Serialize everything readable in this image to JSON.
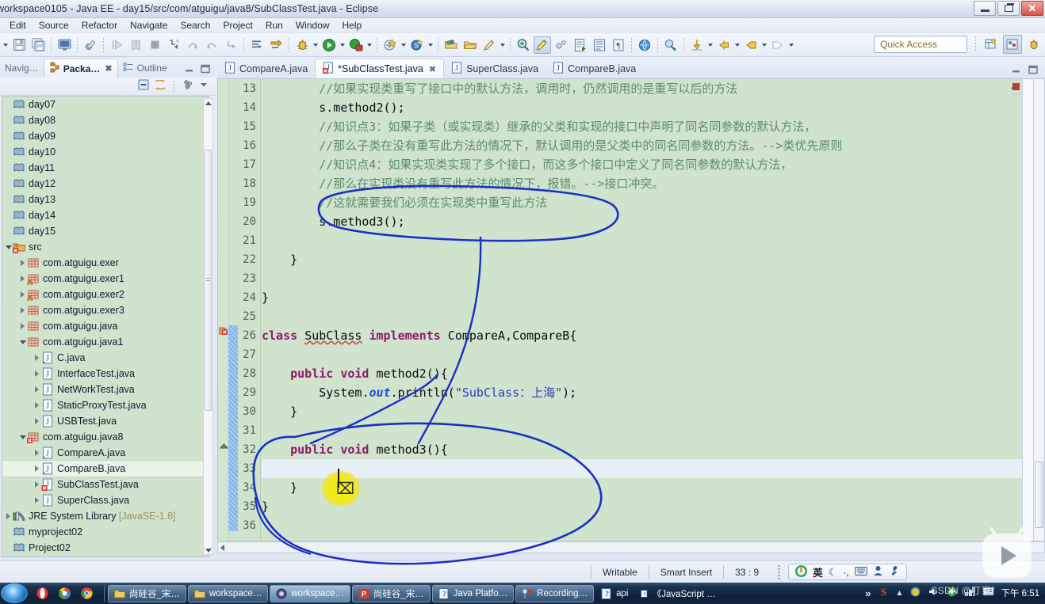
{
  "window": {
    "title": "workspace0105 - Java EE - day15/src/com/atguigu/java8/SubClassTest.java - Eclipse",
    "controls": {
      "minimize": "–",
      "restore": "❐",
      "close": "✕"
    }
  },
  "menu": {
    "items": [
      "Edit",
      "Source",
      "Refactor",
      "Navigate",
      "Search",
      "Project",
      "Run",
      "Window",
      "Help"
    ]
  },
  "toolbar": {
    "quick_access_placeholder": "Quick Access",
    "icons": [
      "save-icon",
      "save-all-icon",
      "console-icon",
      "skip-breakpoints-icon",
      "resume-icon",
      "suspend-icon",
      "terminate-icon",
      "step-into-icon",
      "step-over-icon",
      "step-return-icon",
      "drop-to-frame-icon",
      "use-step-filters-icon",
      "external-tools-icon",
      "debug-icon",
      "run-icon",
      "run-last-tool-icon",
      "new-java-project-icon",
      "new-java-class-icon",
      "open-type-icon",
      "open-task-icon",
      "edit-icon",
      "search-icon",
      "toggle-mark-occurrences-icon",
      "pin-editor-icon",
      "next-annotation-icon",
      "previous-annotation-icon",
      "last-edit-location-icon",
      "back-icon",
      "forward-icon"
    ]
  },
  "left_panel": {
    "tabs": [
      {
        "label": "Navig…",
        "icon": "navigator-icon",
        "active": false
      },
      {
        "label": "Packa…",
        "icon": "package-explorer-icon",
        "active": true,
        "closeable": true
      },
      {
        "label": "Outline",
        "icon": "outline-icon",
        "active": false
      }
    ],
    "view_controls": [
      "collapse-all-icon",
      "link-with-editor-icon",
      "view-menu-icon",
      "view-menu-chevron-icon"
    ],
    "tree": [
      {
        "label": "day07",
        "icon": "java-project-icon",
        "indent": 0,
        "arrow": "none"
      },
      {
        "label": "day08",
        "icon": "java-project-icon",
        "indent": 0,
        "arrow": "none"
      },
      {
        "label": "day09",
        "icon": "java-project-icon",
        "indent": 0,
        "arrow": "none"
      },
      {
        "label": "day10",
        "icon": "java-project-icon",
        "indent": 0,
        "arrow": "none"
      },
      {
        "label": "day11",
        "icon": "java-project-icon",
        "indent": 0,
        "arrow": "none"
      },
      {
        "label": "day12",
        "icon": "java-project-icon",
        "indent": 0,
        "arrow": "none"
      },
      {
        "label": "day13",
        "icon": "java-project-icon",
        "indent": 0,
        "arrow": "none"
      },
      {
        "label": "day14",
        "icon": "java-project-icon",
        "indent": 0,
        "arrow": "none"
      },
      {
        "label": "day15",
        "icon": "java-project-icon",
        "indent": 0,
        "arrow": "none"
      },
      {
        "label": "src",
        "icon": "source-folder-error-icon",
        "indent": 0,
        "arrow": "open"
      },
      {
        "label": "com.atguigu.exer",
        "icon": "package-icon",
        "indent": 1,
        "arrow": "closed"
      },
      {
        "label": "com.atguigu.exer1",
        "icon": "package-warning-icon",
        "indent": 1,
        "arrow": "closed"
      },
      {
        "label": "com.atguigu.exer2",
        "icon": "package-warning-icon",
        "indent": 1,
        "arrow": "closed"
      },
      {
        "label": "com.atguigu.exer3",
        "icon": "package-icon",
        "indent": 1,
        "arrow": "closed"
      },
      {
        "label": "com.atguigu.java",
        "icon": "package-icon",
        "indent": 1,
        "arrow": "closed"
      },
      {
        "label": "com.atguigu.java1",
        "icon": "package-icon",
        "indent": 1,
        "arrow": "open"
      },
      {
        "label": "C.java",
        "icon": "java-interface-file-icon",
        "indent": 2,
        "arrow": "closed"
      },
      {
        "label": "InterfaceTest.java",
        "icon": "java-file-icon",
        "indent": 2,
        "arrow": "closed"
      },
      {
        "label": "NetWorkTest.java",
        "icon": "java-file-icon",
        "indent": 2,
        "arrow": "closed"
      },
      {
        "label": "StaticProxyTest.java",
        "icon": "java-file-icon",
        "indent": 2,
        "arrow": "closed"
      },
      {
        "label": "USBTest.java",
        "icon": "java-file-icon",
        "indent": 2,
        "arrow": "closed"
      },
      {
        "label": "com.atguigu.java8",
        "icon": "package-error-icon",
        "indent": 1,
        "arrow": "open"
      },
      {
        "label": "CompareA.java",
        "icon": "java-interface-file-icon",
        "indent": 2,
        "arrow": "closed"
      },
      {
        "label": "CompareB.java",
        "icon": "java-interface-file-icon",
        "indent": 2,
        "arrow": "closed",
        "selected": true
      },
      {
        "label": "SubClassTest.java",
        "icon": "java-file-error-icon",
        "indent": 2,
        "arrow": "closed"
      },
      {
        "label": "SuperClass.java",
        "icon": "java-file-icon",
        "indent": 2,
        "arrow": "closed"
      },
      {
        "label": "JRE System Library",
        "suffix": "[JavaSE-1.8]",
        "icon": "jre-library-icon",
        "indent": 0,
        "arrow": "closed"
      },
      {
        "label": "myproject02",
        "icon": "java-project-icon",
        "indent": 0,
        "arrow": "none"
      },
      {
        "label": "Project02",
        "icon": "java-project-icon",
        "indent": 0,
        "arrow": "none"
      }
    ]
  },
  "editor": {
    "tabs": [
      {
        "label": "CompareA.java",
        "icon": "java-interface-file-icon",
        "active": false,
        "dirty": false
      },
      {
        "label": "*SubClassTest.java",
        "icon": "java-file-error-icon",
        "active": true,
        "dirty": true,
        "closeable": true
      },
      {
        "label": "SuperClass.java",
        "icon": "java-file-icon",
        "active": false,
        "dirty": false
      },
      {
        "label": "CompareB.java",
        "icon": "java-interface-file-icon",
        "active": false,
        "dirty": false
      }
    ],
    "tab_controls": [
      "minimize-icon",
      "maximize-icon"
    ],
    "first_visible_line": 13,
    "lines": [
      {
        "n": 13,
        "indent": 8,
        "tokens": [
          {
            "t": "//如果实现类重写了接口中的默认方法，调用时，仍然调用的是重写以后的方法",
            "c": "cmt"
          }
        ]
      },
      {
        "n": 14,
        "indent": 8,
        "tokens": [
          {
            "t": "s.method2();",
            "c": "typ"
          }
        ]
      },
      {
        "n": 15,
        "indent": 8,
        "tokens": [
          {
            "t": "//知识点3：如果子类（或实现类）继承的父类和实现的接口中声明了同名同参数的默认方法，",
            "c": "cmt"
          }
        ]
      },
      {
        "n": 16,
        "indent": 8,
        "tokens": [
          {
            "t": "//那么子类在没有重写此方法的情况下，默认调用的是父类中的同名同参数的方法。-->类优先原则",
            "c": "cmt"
          }
        ]
      },
      {
        "n": 17,
        "indent": 8,
        "tokens": [
          {
            "t": "//知识点4：如果实现类实现了多个接口，而这多个接口中定义了同名同参数的默认方法，",
            "c": "cmt"
          }
        ]
      },
      {
        "n": 18,
        "indent": 8,
        "tokens": [
          {
            "t": "//那么在实现类没有重写此方法的情况下，报错。-->接口冲突。",
            "c": "cmt"
          }
        ]
      },
      {
        "n": 19,
        "indent": 8,
        "tokens": [
          {
            "t": "//这就需要我们必须在实现类中重写此方法",
            "c": "cmt"
          }
        ]
      },
      {
        "n": 20,
        "indent": 8,
        "tokens": [
          {
            "t": "s.method3();",
            "c": "typ"
          }
        ]
      },
      {
        "n": 21,
        "indent": 0,
        "tokens": []
      },
      {
        "n": 22,
        "indent": 4,
        "tokens": [
          {
            "t": "}",
            "c": "typ"
          }
        ]
      },
      {
        "n": 23,
        "indent": 0,
        "tokens": []
      },
      {
        "n": 24,
        "indent": 0,
        "tokens": [
          {
            "t": "}",
            "c": "typ"
          }
        ]
      },
      {
        "n": 25,
        "indent": 0,
        "tokens": []
      },
      {
        "n": 26,
        "indent": 0,
        "tokens": [
          {
            "t": "class ",
            "c": "kw"
          },
          {
            "t": "SubClass",
            "c": "err"
          },
          {
            "t": " ",
            "c": "typ"
          },
          {
            "t": "implements",
            "c": "kw"
          },
          {
            "t": " CompareA,CompareB{",
            "c": "typ"
          }
        ]
      },
      {
        "n": 27,
        "indent": 0,
        "tokens": []
      },
      {
        "n": 28,
        "indent": 4,
        "tokens": [
          {
            "t": "public void ",
            "c": "kw"
          },
          {
            "t": "method2(){",
            "c": "typ"
          }
        ]
      },
      {
        "n": 29,
        "indent": 8,
        "tokens": [
          {
            "t": "System.",
            "c": "typ"
          },
          {
            "t": "out",
            "c": "fld"
          },
          {
            "t": ".println(",
            "c": "typ"
          },
          {
            "t": "\"SubClass：上海\"",
            "c": "str"
          },
          {
            "t": ");",
            "c": "typ"
          }
        ]
      },
      {
        "n": 30,
        "indent": 4,
        "tokens": [
          {
            "t": "}",
            "c": "typ"
          }
        ]
      },
      {
        "n": 31,
        "indent": 0,
        "tokens": []
      },
      {
        "n": 32,
        "indent": 4,
        "tokens": [
          {
            "t": "public void ",
            "c": "kw"
          },
          {
            "t": "method3(){",
            "c": "typ"
          }
        ]
      },
      {
        "n": 33,
        "indent": 0,
        "tokens": [],
        "highlight": true
      },
      {
        "n": 34,
        "indent": 4,
        "tokens": [
          {
            "t": "}",
            "c": "typ"
          }
        ]
      },
      {
        "n": 35,
        "indent": 0,
        "tokens": [
          {
            "t": "}",
            "c": "typ"
          }
        ]
      },
      {
        "n": 36,
        "indent": 0,
        "tokens": []
      }
    ]
  },
  "statusbar": {
    "writable": "Writable",
    "insert_mode": "Smart Insert",
    "cursor_position": "33 : 9",
    "ime": {
      "mode": "英",
      "icons": [
        "ime-logo-icon",
        "moon-icon",
        "punctuation-icon",
        "keyboard-icon",
        "user-icon",
        "wrench-icon"
      ]
    }
  },
  "taskbar": {
    "start": "start-orb",
    "quick_launch": [
      "show-desktop-icon",
      "opera-icon",
      "chrome-canary-icon",
      "chrome-icon"
    ],
    "buttons": [
      {
        "label": "尚硅谷_宋…",
        "icon": "folder-icon",
        "active": false
      },
      {
        "label": "workspace…",
        "icon": "folder-icon",
        "active": false
      },
      {
        "label": "workspace…",
        "icon": "eclipse-icon",
        "active": true
      },
      {
        "label": "尚硅谷_宋…",
        "icon": "powerpoint-icon",
        "active": false
      },
      {
        "label": "Java Platfo…",
        "icon": "help-icon",
        "active": false
      },
      {
        "label": "Recording…",
        "icon": "recorder-icon",
        "active": false
      },
      {
        "label": "api",
        "icon": "help-icon",
        "active": false,
        "plain": true
      },
      {
        "label": "《JavaScript 语言参考…",
        "icon": "help-icon",
        "active": false,
        "plain": true
      }
    ],
    "overflow": "»",
    "tray": [
      "sogou-icon",
      "tray-chevron-icon",
      "security-icon",
      "volume-icon",
      "update-icon",
      "network-icon",
      "app-icon",
      "ime-tray-icon"
    ],
    "clock": "下午 6:51",
    "watermark": "CSDN @叮当！"
  },
  "colors": {
    "editor_background": "#cfe3cd",
    "panel_background": "#cfe3cd",
    "keyword": "#8a1a6b",
    "comment": "#5f8a72",
    "string": "#2c3fb5",
    "field": "#1e4fd8",
    "ink_annotation": "#1a2fc4",
    "highlight_cursor": "#f0e414",
    "taskbar": "#16283f"
  }
}
